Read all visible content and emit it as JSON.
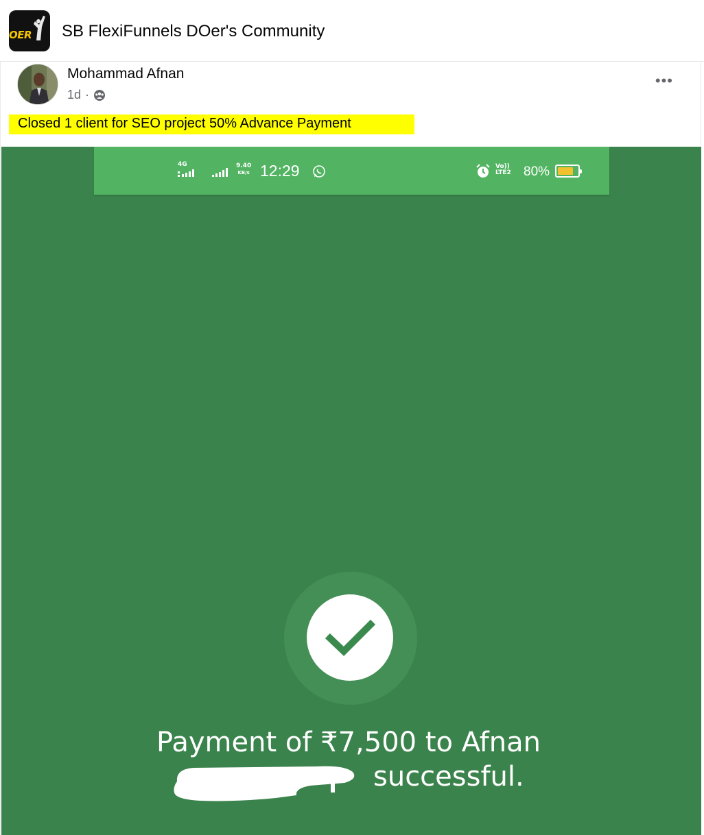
{
  "group": {
    "title": "SB FlexiFunnels DOer's Community",
    "logo_text": "OER"
  },
  "post": {
    "author": "Mohammad Afnan",
    "time": "1d",
    "separator": "·",
    "privacy_icon": "group-icon",
    "more_label": "•••",
    "text": "Closed 1 client for SEO project 50% Advance Payment",
    "highlight_color": "#ffff00"
  },
  "image": {
    "background_color": "#3b834c",
    "status_bar": {
      "network_label": "4G",
      "speed_value": "9.40",
      "speed_unit": "KB/s",
      "time": "12:29",
      "volte_label": "Vo)) LTE2",
      "battery_percent": "80%",
      "battery_level": 0.8,
      "icons": [
        "signal-icon",
        "whatsapp-icon",
        "alarm-icon",
        "battery-icon"
      ]
    },
    "success_icon": "checkmark-icon",
    "payment_line1": "Payment of ₹7,500 to Afnan",
    "payment_line2": "successful."
  }
}
